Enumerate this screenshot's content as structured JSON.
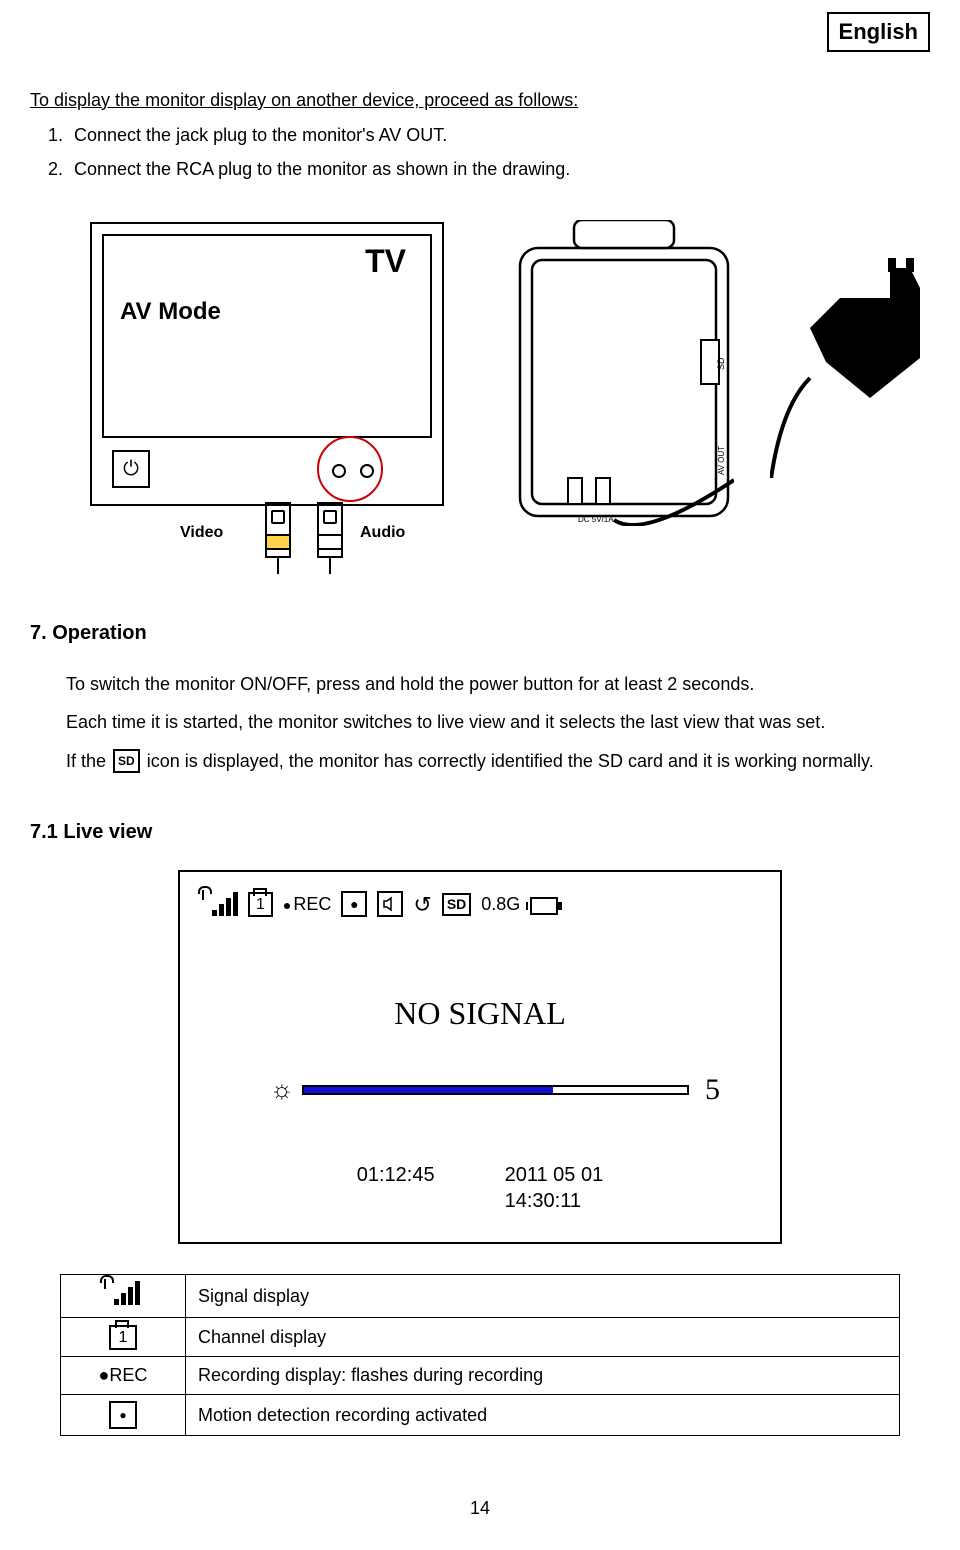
{
  "langLabel": "English",
  "intro": "To display the monitor display on another device, proceed as follows:",
  "steps": [
    "Connect the jack plug to the monitor's AV OUT.",
    "Connect the RCA plug to the monitor as shown in the drawing."
  ],
  "diagram1": {
    "tvLabel": "TV",
    "avModeLabel": "AV Mode",
    "power": "⏻",
    "videoLabel": "Video",
    "audioLabel": "Audio",
    "sideLabels": {
      "sd": "SD",
      "avout": "AV OUT",
      "dc": "DC 5V/1A"
    }
  },
  "section7": {
    "heading": "7. Operation",
    "p1": "To switch the monitor ON/OFF, press and hold the power button for at least 2 seconds.",
    "p2": "Each time it is started, the monitor switches to live view and it selects the last view that was set.",
    "p3_pre": "If the ",
    "p3_icon": "SD",
    "p3_post": " icon is displayed, the monitor has correctly identified the SD card and it is working normally."
  },
  "section71": {
    "heading": "7.1 Live view",
    "screen": {
      "channel": "1",
      "rec": "REC",
      "motion": "●",
      "speaker": "🔊",
      "refresh": "↺",
      "sd": "SD",
      "storage": "0.8G",
      "noSignal": "NO SIGNAL",
      "brightIcon": "☼",
      "brightValue": "5",
      "time": "01:12:45",
      "date": "2011  05  01",
      "clock": "14:30:11"
    }
  },
  "legend": [
    {
      "label": "Signal display"
    },
    {
      "icon": "1",
      "label": "Channel display"
    },
    {
      "icon": "●REC",
      "label": "Recording display: flashes during recording"
    },
    {
      "label": "Motion detection recording activated"
    }
  ],
  "pageNum": "14"
}
